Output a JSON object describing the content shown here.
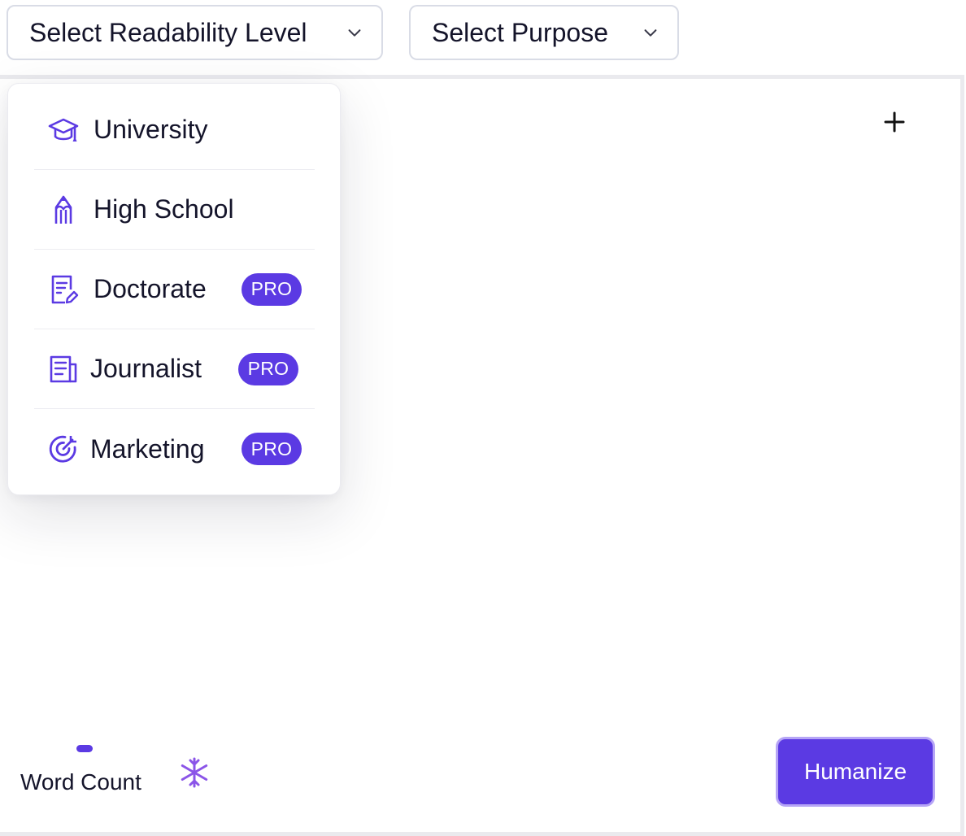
{
  "toolbar": {
    "readability_label": "Select Readability Level",
    "purpose_label": "Select Purpose"
  },
  "dropdown": {
    "items": [
      {
        "label": "University",
        "icon": "graduation-cap-icon",
        "pro": false
      },
      {
        "label": "High School",
        "icon": "pencil-school-icon",
        "pro": false
      },
      {
        "label": "Doctorate",
        "icon": "document-edit-icon",
        "pro": true
      },
      {
        "label": "Journalist",
        "icon": "newspaper-icon",
        "pro": true
      },
      {
        "label": "Marketing",
        "icon": "target-arrow-icon",
        "pro": true
      }
    ],
    "pro_label": "PRO"
  },
  "footer": {
    "word_count_label": "Word Count",
    "humanize_label": "Humanize"
  },
  "colors": {
    "accent": "#5b3ae3",
    "icon_purple": "#5b3ae3",
    "humanize_border": "#b6a5f6",
    "panel_border": "#eaeaee",
    "select_border": "#d9dce6"
  }
}
